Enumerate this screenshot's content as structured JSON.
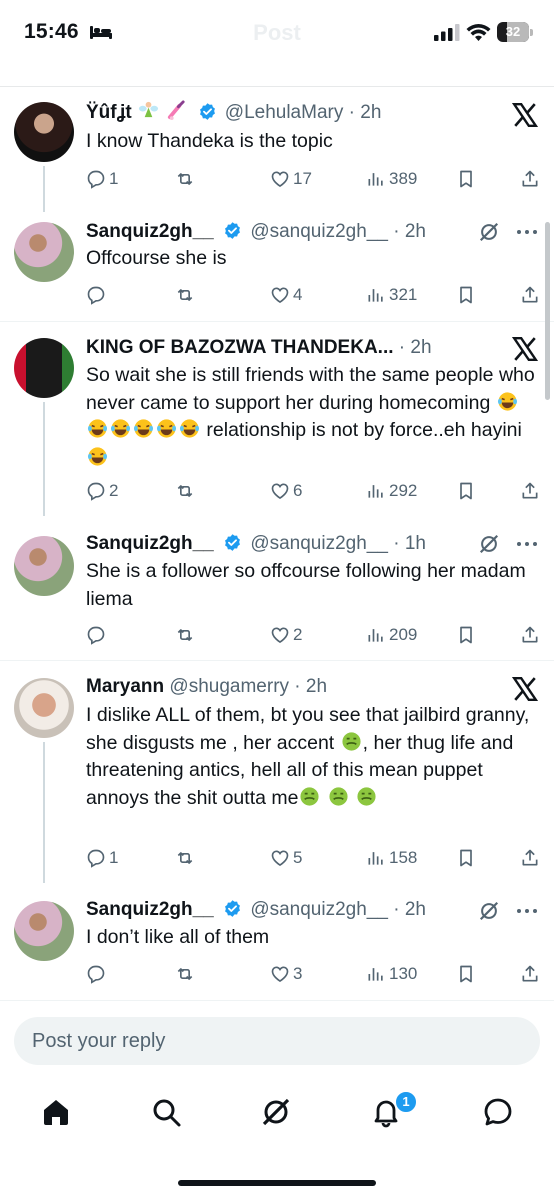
{
  "status_bar": {
    "time": "15:46",
    "battery": "32",
    "battery_level_percent": 32,
    "header_title": "Post",
    "icons": [
      "bed-icon",
      "signal-icon",
      "wifi-icon",
      "battery-icon"
    ]
  },
  "colors": {
    "accent": "#1d9bf0",
    "text_primary": "#0f1419",
    "text_secondary": "#536471",
    "divider": "#eff3f4",
    "thread_line": "#cfd9de"
  },
  "tweets": [
    {
      "name": "Ÿûfʝt",
      "handle": "@LehulaMary",
      "time": "2h",
      "text": "I know Thandeka is the topic",
      "replies": "1",
      "retweets": "",
      "likes": "17",
      "views": "389",
      "verified": true,
      "name_emojis": [
        "fairy",
        "nail-polish"
      ],
      "corner_icon": "x-logo-icon"
    },
    {
      "name": "Sanquiz2gh__",
      "handle": "@sanquiz2gh__",
      "time": "2h",
      "text": "Offcourse she is",
      "replies": "",
      "retweets": "",
      "likes": "4",
      "views": "321",
      "verified": true,
      "corner_icon": "grok-icon"
    },
    {
      "name": "KING OF BAZOZWA THANDEKA...",
      "handle": "",
      "time": "2h",
      "text_part1": "So wait she is still friends with the same people who never came to support her during homecoming",
      "text_part2": " relationship is not by force..eh hayini",
      "replies": "2",
      "retweets": "",
      "likes": "6",
      "views": "292",
      "verified": false,
      "corner_icon": "x-logo-icon"
    },
    {
      "name": "Sanquiz2gh__",
      "handle": "@sanquiz2gh__",
      "time": "1h",
      "text": "She is a follower so offcourse following her madam liema",
      "replies": "",
      "retweets": "",
      "likes": "2",
      "views": "209",
      "verified": true,
      "corner_icon": "grok-icon"
    },
    {
      "name": "Maryann",
      "handle": "@shugamerry",
      "time": "2h",
      "text_part1": "I dislike ALL of them, bt you see that jailbird granny, she disgusts me , her accent",
      "text_part2": ", her thug life and threatening antics, hell all of this mean puppet annoys the shit outta me",
      "replies": "1",
      "retweets": "",
      "likes": "5",
      "views": "158",
      "verified": false,
      "corner_icon": "x-logo-icon"
    },
    {
      "name": "Sanquiz2gh__",
      "handle": "@sanquiz2gh__",
      "time": "2h",
      "text": "I don’t like all of them",
      "replies": "",
      "retweets": "",
      "likes": "3",
      "views": "130",
      "verified": true,
      "corner_icon": "grok-icon"
    }
  ],
  "reply_box": {
    "placeholder": "Post your reply"
  },
  "bottom_nav": {
    "items": [
      "home-icon",
      "search-icon",
      "grok-icon",
      "notifications-icon",
      "messages-icon"
    ],
    "notification_count": "1"
  }
}
